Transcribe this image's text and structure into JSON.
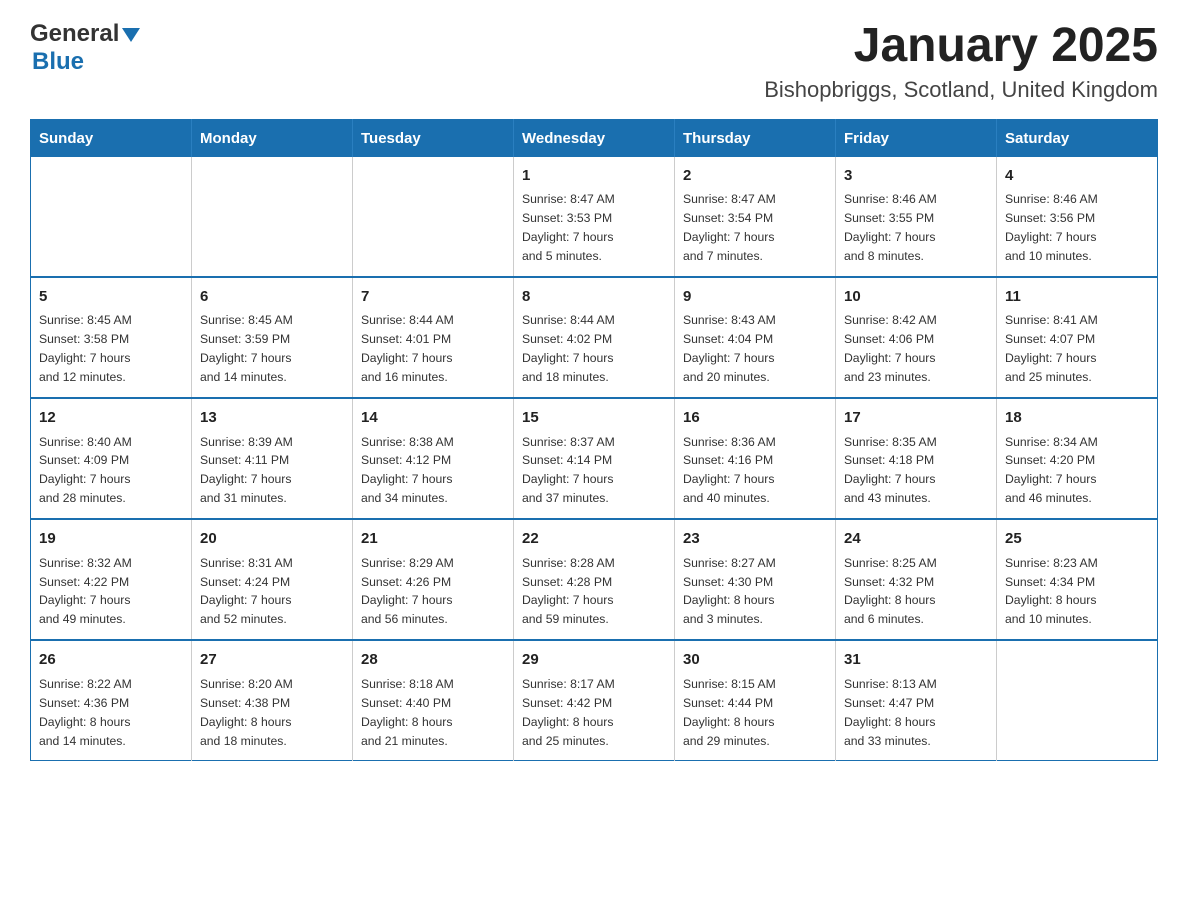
{
  "header": {
    "logo_general": "General",
    "logo_blue": "Blue",
    "title": "January 2025",
    "subtitle": "Bishopbriggs, Scotland, United Kingdom"
  },
  "calendar": {
    "days_of_week": [
      "Sunday",
      "Monday",
      "Tuesday",
      "Wednesday",
      "Thursday",
      "Friday",
      "Saturday"
    ],
    "weeks": [
      [
        {
          "day": "",
          "info": ""
        },
        {
          "day": "",
          "info": ""
        },
        {
          "day": "",
          "info": ""
        },
        {
          "day": "1",
          "info": "Sunrise: 8:47 AM\nSunset: 3:53 PM\nDaylight: 7 hours\nand 5 minutes."
        },
        {
          "day": "2",
          "info": "Sunrise: 8:47 AM\nSunset: 3:54 PM\nDaylight: 7 hours\nand 7 minutes."
        },
        {
          "day": "3",
          "info": "Sunrise: 8:46 AM\nSunset: 3:55 PM\nDaylight: 7 hours\nand 8 minutes."
        },
        {
          "day": "4",
          "info": "Sunrise: 8:46 AM\nSunset: 3:56 PM\nDaylight: 7 hours\nand 10 minutes."
        }
      ],
      [
        {
          "day": "5",
          "info": "Sunrise: 8:45 AM\nSunset: 3:58 PM\nDaylight: 7 hours\nand 12 minutes."
        },
        {
          "day": "6",
          "info": "Sunrise: 8:45 AM\nSunset: 3:59 PM\nDaylight: 7 hours\nand 14 minutes."
        },
        {
          "day": "7",
          "info": "Sunrise: 8:44 AM\nSunset: 4:01 PM\nDaylight: 7 hours\nand 16 minutes."
        },
        {
          "day": "8",
          "info": "Sunrise: 8:44 AM\nSunset: 4:02 PM\nDaylight: 7 hours\nand 18 minutes."
        },
        {
          "day": "9",
          "info": "Sunrise: 8:43 AM\nSunset: 4:04 PM\nDaylight: 7 hours\nand 20 minutes."
        },
        {
          "day": "10",
          "info": "Sunrise: 8:42 AM\nSunset: 4:06 PM\nDaylight: 7 hours\nand 23 minutes."
        },
        {
          "day": "11",
          "info": "Sunrise: 8:41 AM\nSunset: 4:07 PM\nDaylight: 7 hours\nand 25 minutes."
        }
      ],
      [
        {
          "day": "12",
          "info": "Sunrise: 8:40 AM\nSunset: 4:09 PM\nDaylight: 7 hours\nand 28 minutes."
        },
        {
          "day": "13",
          "info": "Sunrise: 8:39 AM\nSunset: 4:11 PM\nDaylight: 7 hours\nand 31 minutes."
        },
        {
          "day": "14",
          "info": "Sunrise: 8:38 AM\nSunset: 4:12 PM\nDaylight: 7 hours\nand 34 minutes."
        },
        {
          "day": "15",
          "info": "Sunrise: 8:37 AM\nSunset: 4:14 PM\nDaylight: 7 hours\nand 37 minutes."
        },
        {
          "day": "16",
          "info": "Sunrise: 8:36 AM\nSunset: 4:16 PM\nDaylight: 7 hours\nand 40 minutes."
        },
        {
          "day": "17",
          "info": "Sunrise: 8:35 AM\nSunset: 4:18 PM\nDaylight: 7 hours\nand 43 minutes."
        },
        {
          "day": "18",
          "info": "Sunrise: 8:34 AM\nSunset: 4:20 PM\nDaylight: 7 hours\nand 46 minutes."
        }
      ],
      [
        {
          "day": "19",
          "info": "Sunrise: 8:32 AM\nSunset: 4:22 PM\nDaylight: 7 hours\nand 49 minutes."
        },
        {
          "day": "20",
          "info": "Sunrise: 8:31 AM\nSunset: 4:24 PM\nDaylight: 7 hours\nand 52 minutes."
        },
        {
          "day": "21",
          "info": "Sunrise: 8:29 AM\nSunset: 4:26 PM\nDaylight: 7 hours\nand 56 minutes."
        },
        {
          "day": "22",
          "info": "Sunrise: 8:28 AM\nSunset: 4:28 PM\nDaylight: 7 hours\nand 59 minutes."
        },
        {
          "day": "23",
          "info": "Sunrise: 8:27 AM\nSunset: 4:30 PM\nDaylight: 8 hours\nand 3 minutes."
        },
        {
          "day": "24",
          "info": "Sunrise: 8:25 AM\nSunset: 4:32 PM\nDaylight: 8 hours\nand 6 minutes."
        },
        {
          "day": "25",
          "info": "Sunrise: 8:23 AM\nSunset: 4:34 PM\nDaylight: 8 hours\nand 10 minutes."
        }
      ],
      [
        {
          "day": "26",
          "info": "Sunrise: 8:22 AM\nSunset: 4:36 PM\nDaylight: 8 hours\nand 14 minutes."
        },
        {
          "day": "27",
          "info": "Sunrise: 8:20 AM\nSunset: 4:38 PM\nDaylight: 8 hours\nand 18 minutes."
        },
        {
          "day": "28",
          "info": "Sunrise: 8:18 AM\nSunset: 4:40 PM\nDaylight: 8 hours\nand 21 minutes."
        },
        {
          "day": "29",
          "info": "Sunrise: 8:17 AM\nSunset: 4:42 PM\nDaylight: 8 hours\nand 25 minutes."
        },
        {
          "day": "30",
          "info": "Sunrise: 8:15 AM\nSunset: 4:44 PM\nDaylight: 8 hours\nand 29 minutes."
        },
        {
          "day": "31",
          "info": "Sunrise: 8:13 AM\nSunset: 4:47 PM\nDaylight: 8 hours\nand 33 minutes."
        },
        {
          "day": "",
          "info": ""
        }
      ]
    ]
  }
}
